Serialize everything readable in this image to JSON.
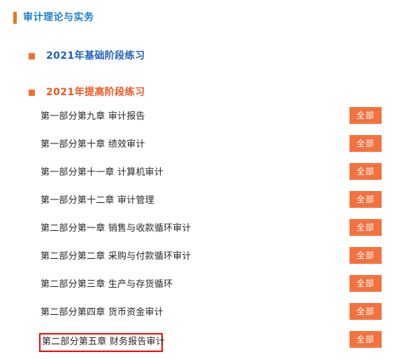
{
  "page": {
    "title": "审计理论与实务",
    "title_accent_color": "#e8761b",
    "title_text_color": "#1f7fd0"
  },
  "sections": [
    {
      "key": "basic",
      "label": "2021年基础阶段练习",
      "bullet_color": "#f2702f",
      "text_color": "#1f5fbf",
      "chapters": []
    },
    {
      "key": "advanced",
      "label": "2021年提高阶段练习",
      "bullet_color": "#f2702f",
      "text_color": "#f2551e",
      "chapters": [
        {
          "name": "第一部分第九章  审计报告",
          "button_label": "全部",
          "highlighted": false
        },
        {
          "name": "第一部分第十章  绩效审计",
          "button_label": "全部",
          "highlighted": false
        },
        {
          "name": "第一部分第十一章  计算机审计",
          "button_label": "全部",
          "highlighted": false
        },
        {
          "name": "第一部分第十二章  审计管理",
          "button_label": "全部",
          "highlighted": false
        },
        {
          "name": "第二部分第一章  销售与收款循环审计",
          "button_label": "全部",
          "highlighted": false
        },
        {
          "name": "第二部分第二章  采购与付款循环审计",
          "button_label": "全部",
          "highlighted": false
        },
        {
          "name": "第二部分第三章  生产与存货循环",
          "button_label": "全部",
          "highlighted": false
        },
        {
          "name": "第二部分第四章  货币资金审计",
          "button_label": "全部",
          "highlighted": false
        },
        {
          "name": "第二部分第五章  财务报告审计",
          "button_label": "全部",
          "highlighted": true
        }
      ]
    }
  ],
  "colors": {
    "button_background": "#f4723f",
    "button_text": "#ffffff",
    "highlight_border": "#ff0000",
    "chapter_text": "#262626"
  }
}
